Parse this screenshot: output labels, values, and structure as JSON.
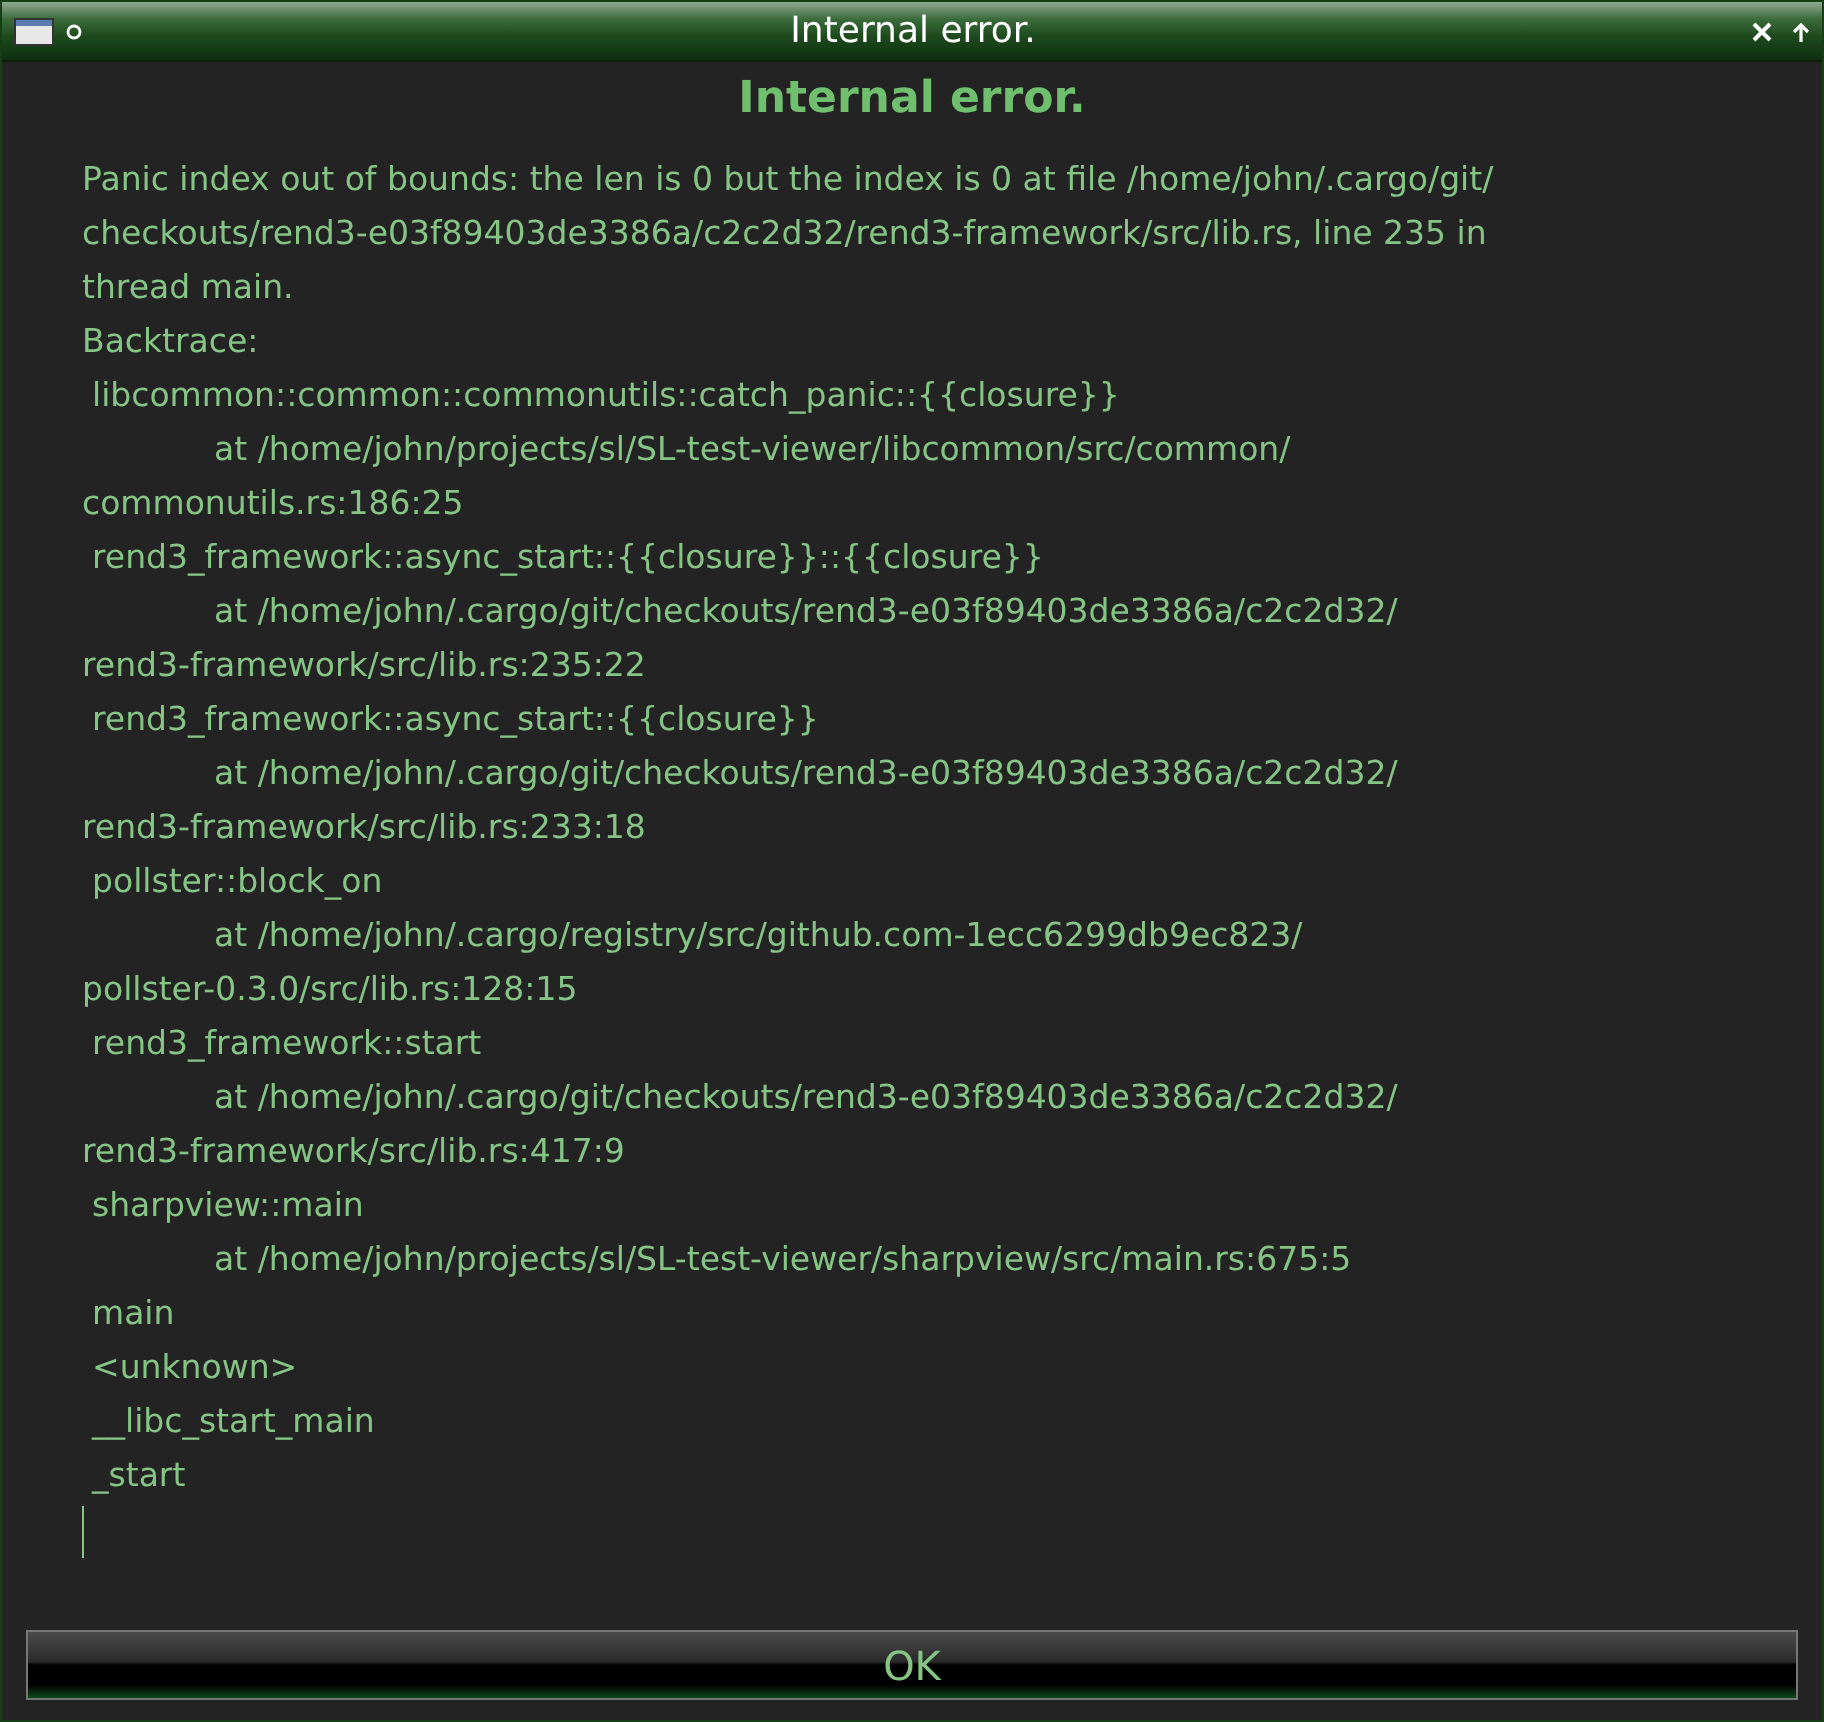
{
  "window": {
    "title": "Internal error."
  },
  "heading": "Internal error.",
  "message_lines": [
    {
      "kind": "text",
      "text": "Panic index out of bounds: the len is 0 but the index is 0 at file /home/john/.cargo/git/"
    },
    {
      "kind": "text",
      "text": "checkouts/rend3-e03f89403de3386a/c2c2d32/rend3-framework/src/lib.rs, line 235 in"
    },
    {
      "kind": "text",
      "text": "thread main."
    },
    {
      "kind": "text",
      "text": "Backtrace:"
    },
    {
      "kind": "frame",
      "text": "libcommon::common::commonutils::catch_panic::{{closure}}"
    },
    {
      "kind": "location",
      "text": "at /home/john/projects/sl/SL-test-viewer/libcommon/src/common/"
    },
    {
      "kind": "text",
      "text": "commonutils.rs:186:25"
    },
    {
      "kind": "frame",
      "text": "rend3_framework::async_start::{{closure}}::{{closure}}"
    },
    {
      "kind": "location",
      "text": "at /home/john/.cargo/git/checkouts/rend3-e03f89403de3386a/c2c2d32/"
    },
    {
      "kind": "text",
      "text": "rend3-framework/src/lib.rs:235:22"
    },
    {
      "kind": "frame",
      "text": "rend3_framework::async_start::{{closure}}"
    },
    {
      "kind": "location",
      "text": "at /home/john/.cargo/git/checkouts/rend3-e03f89403de3386a/c2c2d32/"
    },
    {
      "kind": "text",
      "text": "rend3-framework/src/lib.rs:233:18"
    },
    {
      "kind": "frame",
      "text": "pollster::block_on"
    },
    {
      "kind": "location",
      "text": "at /home/john/.cargo/registry/src/github.com-1ecc6299db9ec823/"
    },
    {
      "kind": "text",
      "text": "pollster-0.3.0/src/lib.rs:128:15"
    },
    {
      "kind": "frame",
      "text": "rend3_framework::start"
    },
    {
      "kind": "location",
      "text": "at /home/john/.cargo/git/checkouts/rend3-e03f89403de3386a/c2c2d32/"
    },
    {
      "kind": "text",
      "text": "rend3-framework/src/lib.rs:417:9"
    },
    {
      "kind": "frame",
      "text": "sharpview::main"
    },
    {
      "kind": "location",
      "text": "at /home/john/projects/sl/SL-test-viewer/sharpview/src/main.rs:675:5"
    },
    {
      "kind": "frame",
      "text": "main"
    },
    {
      "kind": "frame",
      "text": "<unknown>"
    },
    {
      "kind": "frame",
      "text": "__libc_start_main"
    },
    {
      "kind": "frame",
      "text": "_start"
    }
  ],
  "buttons": [
    "OK"
  ]
}
